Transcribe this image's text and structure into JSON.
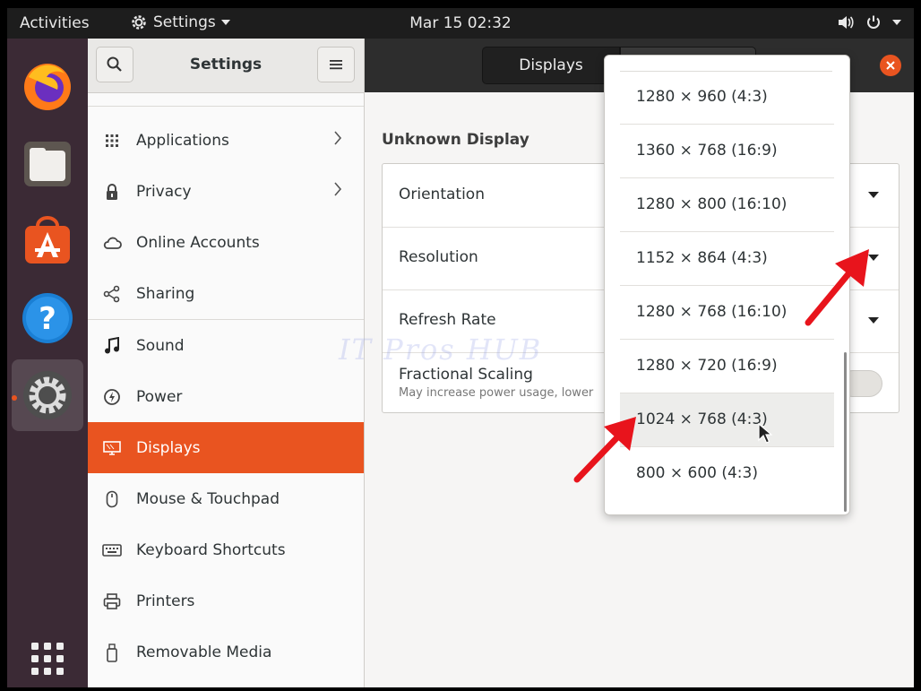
{
  "topbar": {
    "activities": "Activities",
    "app_menu": "Settings",
    "clock": "Mar 15  02:32"
  },
  "dock": {
    "items": [
      "firefox-icon",
      "files-icon",
      "software-icon",
      "help-icon",
      "settings-icon",
      "show-apps-icon"
    ]
  },
  "header": {
    "title": "Settings",
    "tab_displays": "Displays"
  },
  "sidebar": {
    "items": [
      {
        "label": "Applications",
        "icon": "applications-icon",
        "chevron": true
      },
      {
        "label": "Privacy",
        "icon": "privacy-icon",
        "chevron": true
      },
      {
        "label": "Online Accounts",
        "icon": "cloud-icon",
        "chevron": false
      },
      {
        "label": "Sharing",
        "icon": "share-icon",
        "chevron": false
      },
      {
        "label": "Sound",
        "icon": "music-icon",
        "chevron": false
      },
      {
        "label": "Power",
        "icon": "power-icon",
        "chevron": false
      },
      {
        "label": "Displays",
        "icon": "display-icon",
        "chevron": false,
        "selected": true
      },
      {
        "label": "Mouse & Touchpad",
        "icon": "mouse-icon",
        "chevron": false
      },
      {
        "label": "Keyboard Shortcuts",
        "icon": "keyboard-icon",
        "chevron": false
      },
      {
        "label": "Printers",
        "icon": "printer-icon",
        "chevron": false
      },
      {
        "label": "Removable Media",
        "icon": "usb-icon",
        "chevron": false
      }
    ]
  },
  "main": {
    "section_title": "Unknown Display",
    "orientation_label": "Orientation",
    "resolution_label": "Resolution",
    "refresh_rate_label": "Refresh Rate",
    "fractional_scaling_label": "Fractional Scaling",
    "fractional_scaling_sub": "May increase power usage, lower"
  },
  "watermark": "IT Pros HUB",
  "resolution_options": [
    "1280 × 960 (4:3)",
    "1360 × 768 (16:9)",
    "1280 × 800 (16:10)",
    "1152 × 864 (4:3)",
    "1280 × 768 (16:10)",
    "1280 × 720 (16:9)",
    "1024 × 768 (4:3)",
    "800 × 600 (4:3)"
  ],
  "hovered_option": "1024 × 768 (4:3)",
  "colors": {
    "accent": "#e95420",
    "dock": "#3b2a35",
    "topbar": "#1d1d1d",
    "annotation_arrow": "#e8141c"
  }
}
